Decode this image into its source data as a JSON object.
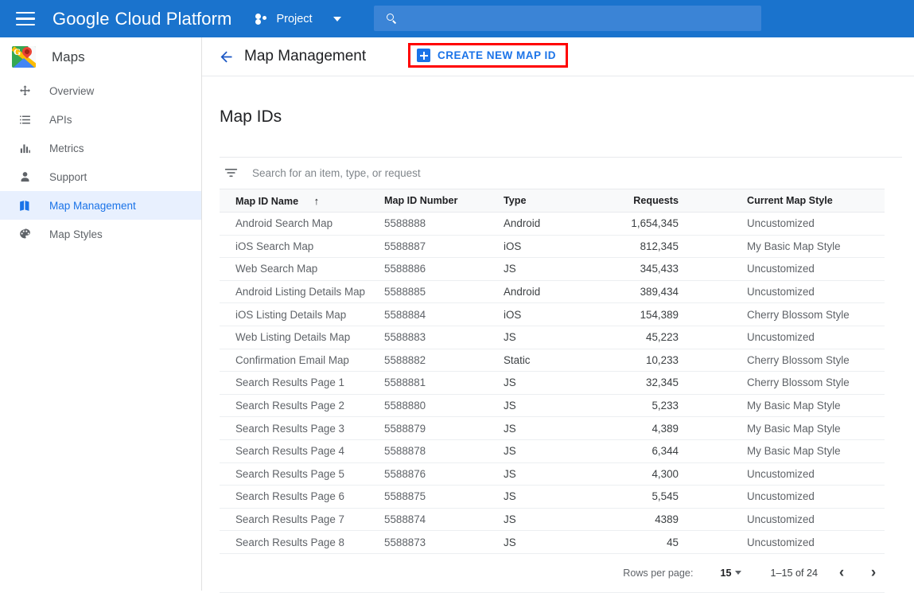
{
  "topbar": {
    "menu_icon": "hamburger-menu-icon",
    "brand_bold": "Google",
    "brand_light": "Cloud Platform",
    "project_label": "Project",
    "project_icon": "project-dots-icon",
    "dropdown_icon": "chevron-down-icon",
    "search_icon": "search-icon",
    "search_value": "",
    "search_placeholder": "",
    "accent_blue": "#1a73cd"
  },
  "sidebar": {
    "product_title": "Maps",
    "product_logo": "google-maps-logo",
    "items": [
      {
        "label": "Overview",
        "icon": "overview-icon",
        "active": false
      },
      {
        "label": "APIs",
        "icon": "list-apis-icon",
        "active": false
      },
      {
        "label": "Metrics",
        "icon": "bar-chart-icon",
        "active": false
      },
      {
        "label": "Support",
        "icon": "person-icon",
        "active": false
      },
      {
        "label": "Map Management",
        "icon": "map-icon",
        "active": true
      },
      {
        "label": "Map Styles",
        "icon": "palette-icon",
        "active": false
      }
    ],
    "active_bg": "#e8f0fe",
    "active_fg": "#1a73e8"
  },
  "page": {
    "back_icon": "back-arrow-icon",
    "title": "Map Management",
    "create_button_label": "CREATE NEW MAP ID",
    "create_button_icon": "plus-box-icon",
    "highlight_color": "#ff0000"
  },
  "card": {
    "heading": "Map IDs",
    "filter_icon": "filter-funnel-icon",
    "filter_value": "",
    "filter_placeholder": "Search for an item, type, or request"
  },
  "table": {
    "columns": [
      "Map ID Name",
      "Map ID Number",
      "Type",
      "Requests",
      "Current Map Style"
    ],
    "sort_column": "Map ID Name",
    "sort_indicator": "↑",
    "rows": [
      {
        "name": "Android Search Map",
        "number": "5588888",
        "type": "Android",
        "requests": "1,654,345",
        "style": "Uncustomized"
      },
      {
        "name": "iOS Search Map",
        "number": "5588887",
        "type": "iOS",
        "requests": "812,345",
        "style": "My Basic Map Style"
      },
      {
        "name": "Web Search Map",
        "number": "5588886",
        "type": "JS",
        "requests": "345,433",
        "style": "Uncustomized"
      },
      {
        "name": "Android Listing Details Map",
        "number": "5588885",
        "type": "Android",
        "requests": "389,434",
        "style": "Uncustomized"
      },
      {
        "name": "iOS Listing Details Map",
        "number": "5588884",
        "type": "iOS",
        "requests": "154,389",
        "style": "Cherry Blossom Style"
      },
      {
        "name": "Web Listing Details Map",
        "number": "5588883",
        "type": "JS",
        "requests": "45,223",
        "style": "Uncustomized"
      },
      {
        "name": "Confirmation Email Map",
        "number": "5588882",
        "type": "Static",
        "requests": "10,233",
        "style": "Cherry Blossom Style"
      },
      {
        "name": "Search Results Page 1",
        "number": "5588881",
        "type": "JS",
        "requests": "32,345",
        "style": "Cherry Blossom Style"
      },
      {
        "name": "Search Results Page 2",
        "number": "5588880",
        "type": "JS",
        "requests": "5,233",
        "style": "My Basic Map Style"
      },
      {
        "name": "Search Results Page 3",
        "number": "5588879",
        "type": "JS",
        "requests": "4,389",
        "style": "My Basic Map Style"
      },
      {
        "name": "Search Results Page 4",
        "number": "5588878",
        "type": "JS",
        "requests": "6,344",
        "style": "My Basic Map Style"
      },
      {
        "name": "Search Results Page 5",
        "number": "5588876",
        "type": "JS",
        "requests": "4,300",
        "style": "Uncustomized"
      },
      {
        "name": "Search Results Page 6",
        "number": "5588875",
        "type": "JS",
        "requests": "5,545",
        "style": "Uncustomized"
      },
      {
        "name": "Search Results Page 7",
        "number": "5588874",
        "type": "JS",
        "requests": "4389",
        "style": "Uncustomized"
      },
      {
        "name": "Search Results Page 8",
        "number": "5588873",
        "type": "JS",
        "requests": "45",
        "style": "Uncustomized"
      }
    ]
  },
  "pagination": {
    "rows_per_page_label": "Rows per page:",
    "rows_per_page_value": "15",
    "range_label": "1–15 of 24",
    "prev_icon": "chevron-left-icon",
    "next_icon": "chevron-right-icon",
    "prev_glyph": "‹",
    "next_glyph": "›"
  }
}
